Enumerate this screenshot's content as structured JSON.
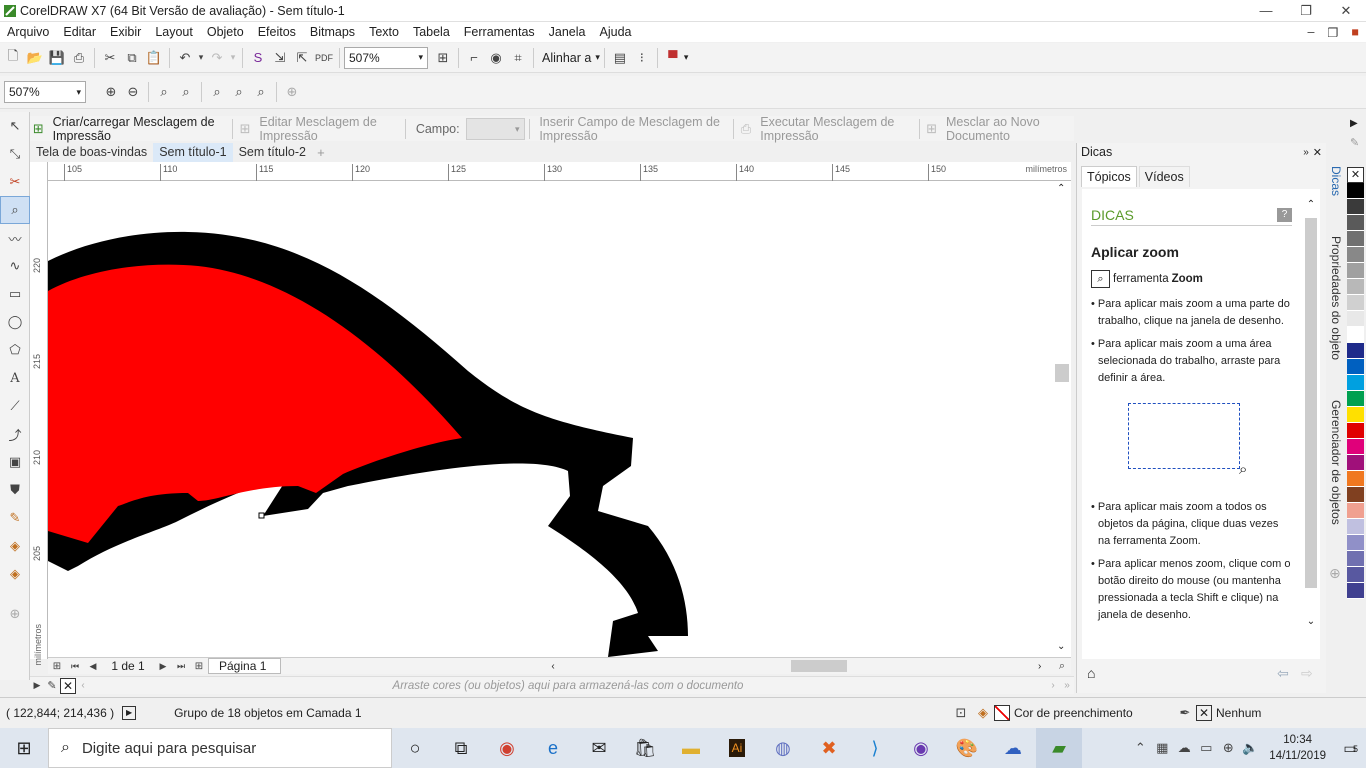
{
  "window": {
    "title": "CorelDRAW X7 (64 Bit Versão de avaliação) - Sem título-1"
  },
  "menu": [
    "Arquivo",
    "Editar",
    "Exibir",
    "Layout",
    "Objeto",
    "Efeitos",
    "Bitmaps",
    "Texto",
    "Tabela",
    "Ferramentas",
    "Janela",
    "Ajuda"
  ],
  "standard_toolbar": {
    "zoom_value": "507%",
    "align_label": "Alinhar a"
  },
  "property_bar": {
    "zoom_value": "507%"
  },
  "merge_toolbar": {
    "create": "Criar/carregar Mesclagem de Impressão",
    "edit": "Editar Mesclagem de Impressão",
    "field_label": "Campo:",
    "insert": "Inserir Campo de Mesclagem de Impressão",
    "execute": "Executar Mesclagem de Impressão",
    "merge_new": "Mesclar ao Novo Documento"
  },
  "doc_tabs": [
    {
      "label": "Tela de boas-vindas",
      "active": false
    },
    {
      "label": "Sem título-1",
      "active": true
    },
    {
      "label": "Sem título-2",
      "active": false
    }
  ],
  "ruler": {
    "h_ticks": [
      "105",
      "110",
      "115",
      "120",
      "125",
      "130",
      "135",
      "140",
      "145",
      "150"
    ],
    "h_unit": "milímetros",
    "v_ticks": [
      "220",
      "215",
      "210",
      "205"
    ],
    "v_unit": "milímetros"
  },
  "page_nav": {
    "count": "1 de 1",
    "page_tab": "Página 1"
  },
  "color_strip_hint": "Arraste cores (ou objetos) aqui para armazená-las com o documento",
  "docker": {
    "title": "Dicas",
    "tabs": [
      "Tópicos",
      "Vídeos"
    ],
    "section": "DICAS",
    "heading": "Aplicar zoom",
    "tool_prefix": "ferramenta",
    "tool_name": "Zoom",
    "tips": [
      "Para aplicar mais zoom a uma parte do trabalho, clique na janela de desenho.",
      "Para aplicar mais zoom a uma área selecionada do trabalho, arraste para definir a área.",
      "Para aplicar mais zoom a todos os objetos da página, clique duas vezes na ferramenta Zoom.",
      "Para aplicar menos zoom, clique com o botão direito do mouse (ou mantenha pressionada a tecla Shift e clique) na janela de desenho."
    ]
  },
  "vertical_tabs": [
    "Dicas",
    "Propriedades do objeto",
    "Gerenciador de objetos"
  ],
  "palette": [
    "#ffffff",
    "#000000",
    "#3a3a3a",
    "#5a5a5a",
    "#707070",
    "#888888",
    "#a0a0a0",
    "#b8b8b8",
    "#d0d0d0",
    "#e8e8e8",
    "#ffffff",
    "#1e2a8a",
    "#0060c0",
    "#00a0e0",
    "#00a050",
    "#ffe000",
    "#e00000",
    "#e0007a",
    "#a0107a",
    "#f07820",
    "#804020",
    "#f0a090",
    "#c0c0e0",
    "#9090c8",
    "#7070b0",
    "#5858a0",
    "#404090"
  ],
  "status": {
    "coords": "( 122,844; 214,436 )",
    "selection": "Grupo de 18 objetos em Camada 1",
    "fill_label": "Cor de preenchimento",
    "outline_label": "Nenhum"
  },
  "taskbar": {
    "search_placeholder": "Digite aqui para pesquisar",
    "time": "10:34",
    "date": "14/11/2019",
    "notif_count": "5"
  },
  "colors": {
    "fill_red": "#ff0000",
    "outline_black": "#000000",
    "dicas_green": "#5a9a2a"
  }
}
